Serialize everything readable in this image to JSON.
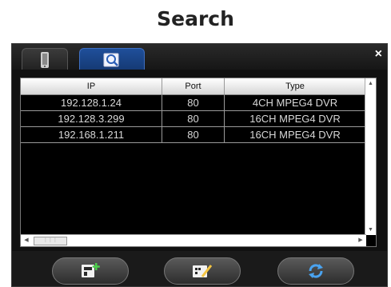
{
  "page": {
    "heading": "Search"
  },
  "tabs": [
    {
      "name": "device-info",
      "icon": "device-icon"
    },
    {
      "name": "search",
      "icon": "magnifier-icon",
      "active": true
    }
  ],
  "table": {
    "headers": {
      "ip": "IP",
      "port": "Port",
      "type": "Type"
    },
    "rows": [
      {
        "ip": "192.128.1.24",
        "port": "80",
        "type": "4CH MPEG4 DVR"
      },
      {
        "ip": "192.128.3.299",
        "port": "80",
        "type": "16CH MPEG4 DVR"
      },
      {
        "ip": "192.168.1.211",
        "port": "80",
        "type": "16CH MPEG4 DVR"
      }
    ]
  },
  "buttons": [
    {
      "name": "add",
      "icon": "add-device-icon"
    },
    {
      "name": "edit",
      "icon": "edit-icon"
    },
    {
      "name": "refresh",
      "icon": "refresh-icon"
    }
  ],
  "colors": {
    "active_tab": "#1f4f9a",
    "window_bg": "#111111",
    "refresh_icon": "#4aa3f0"
  }
}
